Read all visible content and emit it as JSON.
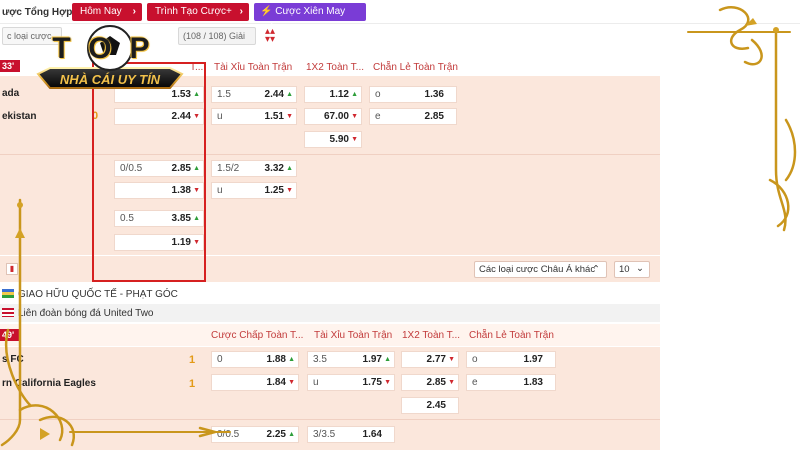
{
  "topbar": {
    "title": "ược Tổng Hợp",
    "tabs": [
      {
        "label": "Hôm Nay"
      },
      {
        "label": "Trình Tạo Cược+"
      },
      {
        "label": "Cược Xiên May Mắn"
      }
    ]
  },
  "toolbar": {
    "bet_type": "c loại cược",
    "league_count": "(108 / 108) Giải",
    "gia_label": "Gia"
  },
  "logo": {
    "top": "TOP",
    "tagline": "NHÀ CÁI UY TÍN"
  },
  "match1": {
    "time": "33'",
    "team1": "ada",
    "team2": "ekistan",
    "score": "0",
    "headers": {
      "ou": "Tài Xỉu Toàn Trận",
      "x12": "1X2 Toàn T...",
      "oe": "Chẵn Lẻ Toàn Trận",
      "hcp_trunc": "T..."
    },
    "rows": [
      {
        "hcp": [
          "",
          "1.53",
          "up"
        ],
        "ou": [
          "1.5",
          "2.44",
          "up"
        ],
        "x12": [
          "",
          "1.12",
          "up"
        ],
        "oe": [
          "o",
          "1.36"
        ]
      },
      {
        "hcp": [
          "",
          "2.44",
          "dn"
        ],
        "ou": [
          "u",
          "1.51",
          "dn"
        ],
        "x12": [
          "",
          "67.00",
          "dn"
        ],
        "oe": [
          "e",
          "2.85"
        ]
      },
      {
        "x12": [
          "",
          "5.90",
          "dn"
        ]
      },
      {
        "hcp": [
          "0/0.5",
          "2.85",
          "up"
        ],
        "ou": [
          "1.5/2",
          "3.32",
          "up"
        ]
      },
      {
        "hcp": [
          "",
          "1.38",
          "dn"
        ],
        "ou": [
          "u",
          "1.25",
          "dn"
        ]
      },
      {
        "hcp": [
          "0.5",
          "3.85",
          "up"
        ]
      },
      {
        "hcp": [
          "",
          "1.19",
          "dn"
        ]
      }
    ],
    "other_bets": "Các loại cược Châu Á khác",
    "page_size": "10"
  },
  "league2": {
    "name": "GIAO HỮU QUỐC TẾ - PHẠT GÓC",
    "sub": "Liên đoàn bóng đá United Two"
  },
  "match2": {
    "time": "49'",
    "team1": "s FC",
    "team2": "rn California Eagles",
    "score1": "1",
    "score2": "1",
    "headers": {
      "hcp": "Cược Chấp Toàn T...",
      "ou": "Tài Xỉu Toàn Trận",
      "x12": "1X2 Toàn T...",
      "oe": "Chẵn Lẻ Toàn Trận"
    },
    "rows": [
      {
        "hcp": [
          "0",
          "1.88",
          "up"
        ],
        "ou": [
          "3.5",
          "1.97",
          "up"
        ],
        "x12": [
          "",
          "2.77",
          "dn"
        ],
        "oe": [
          "o",
          "1.97"
        ]
      },
      {
        "hcp": [
          "",
          "1.84",
          "dn"
        ],
        "ou": [
          "u",
          "1.75",
          "dn"
        ],
        "x12": [
          "",
          "2.85",
          "dn"
        ],
        "oe": [
          "e",
          "1.83"
        ]
      },
      {
        "x12": [
          "",
          "2.45",
          ""
        ]
      },
      {
        "hcp": [
          "0/0.5",
          "2.25",
          "up"
        ],
        "ou": [
          "3/3.5",
          "1.64",
          ""
        ]
      }
    ]
  },
  "colors": {
    "accent_red": "#c8102e",
    "purple": "#7a3cd6",
    "gold": "#e39a16"
  }
}
